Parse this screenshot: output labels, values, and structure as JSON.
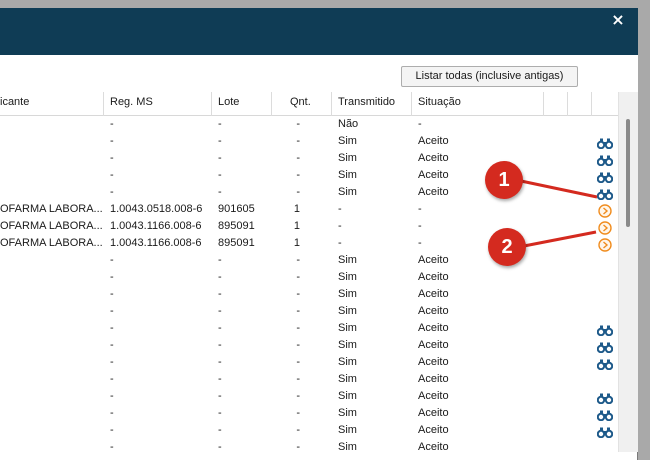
{
  "window": {
    "close_label": "×"
  },
  "toolbar": {
    "list_all_label": "Listar todas (inclusive antigas)"
  },
  "grid": {
    "headers": {
      "fabricante": "icante",
      "reg_ms": "Reg. MS",
      "lote": "Lote",
      "qnt": "Qnt.",
      "transmitido": "Transmitido",
      "situacao": "Situação"
    },
    "rows": [
      {
        "fab": "",
        "reg": "-",
        "lote": "-",
        "qnt": "-",
        "trans": "Não",
        "sit": "-",
        "icon": "none"
      },
      {
        "fab": "",
        "reg": "-",
        "lote": "-",
        "qnt": "-",
        "trans": "Sim",
        "sit": "Aceito",
        "icon": "binoculars"
      },
      {
        "fab": "",
        "reg": "-",
        "lote": "-",
        "qnt": "-",
        "trans": "Sim",
        "sit": "Aceito",
        "icon": "binoculars"
      },
      {
        "fab": "",
        "reg": "-",
        "lote": "-",
        "qnt": "-",
        "trans": "Sim",
        "sit": "Aceito",
        "icon": "binoculars"
      },
      {
        "fab": "",
        "reg": "-",
        "lote": "-",
        "qnt": "-",
        "trans": "Sim",
        "sit": "Aceito",
        "icon": "binoculars"
      },
      {
        "fab": "OFARMA LABORA...",
        "reg": "1.0043.0518.008-6",
        "lote": "901605",
        "qnt": "1",
        "trans": "-",
        "sit": "-",
        "icon": "arrow"
      },
      {
        "fab": "OFARMA LABORA...",
        "reg": "1.0043.1166.008-6",
        "lote": "895091",
        "qnt": "1",
        "trans": "-",
        "sit": "-",
        "icon": "arrow"
      },
      {
        "fab": "OFARMA LABORA...",
        "reg": "1.0043.1166.008-6",
        "lote": "895091",
        "qnt": "1",
        "trans": "-",
        "sit": "-",
        "icon": "arrow"
      },
      {
        "fab": "",
        "reg": "-",
        "lote": "-",
        "qnt": "-",
        "trans": "Sim",
        "sit": "Aceito",
        "icon": "none"
      },
      {
        "fab": "",
        "reg": "-",
        "lote": "-",
        "qnt": "-",
        "trans": "Sim",
        "sit": "Aceito",
        "icon": "none"
      },
      {
        "fab": "",
        "reg": "-",
        "lote": "-",
        "qnt": "-",
        "trans": "Sim",
        "sit": "Aceito",
        "icon": "none"
      },
      {
        "fab": "",
        "reg": "-",
        "lote": "-",
        "qnt": "-",
        "trans": "Sim",
        "sit": "Aceito",
        "icon": "none"
      },
      {
        "fab": "",
        "reg": "-",
        "lote": "-",
        "qnt": "-",
        "trans": "Sim",
        "sit": "Aceito",
        "icon": "binoculars"
      },
      {
        "fab": "",
        "reg": "-",
        "lote": "-",
        "qnt": "-",
        "trans": "Sim",
        "sit": "Aceito",
        "icon": "binoculars"
      },
      {
        "fab": "",
        "reg": "-",
        "lote": "-",
        "qnt": "-",
        "trans": "Sim",
        "sit": "Aceito",
        "icon": "binoculars"
      },
      {
        "fab": "",
        "reg": "-",
        "lote": "-",
        "qnt": "-",
        "trans": "Sim",
        "sit": "Aceito",
        "icon": "none"
      },
      {
        "fab": "",
        "reg": "-",
        "lote": "-",
        "qnt": "-",
        "trans": "Sim",
        "sit": "Aceito",
        "icon": "binoculars"
      },
      {
        "fab": "",
        "reg": "-",
        "lote": "-",
        "qnt": "-",
        "trans": "Sim",
        "sit": "Aceito",
        "icon": "binoculars"
      },
      {
        "fab": "",
        "reg": "-",
        "lote": "-",
        "qnt": "-",
        "trans": "Sim",
        "sit": "Aceito",
        "icon": "binoculars"
      },
      {
        "fab": "",
        "reg": "-",
        "lote": "-",
        "qnt": "-",
        "trans": "Sim",
        "sit": "Aceito",
        "icon": "none"
      }
    ]
  },
  "callouts": [
    {
      "label": "1"
    },
    {
      "label": "2"
    }
  ],
  "colors": {
    "titlebar": "#0f3c55",
    "callout": "#d42a1f",
    "icon_blue": "#1e5a8a",
    "icon_orange": "#f08c1e"
  }
}
